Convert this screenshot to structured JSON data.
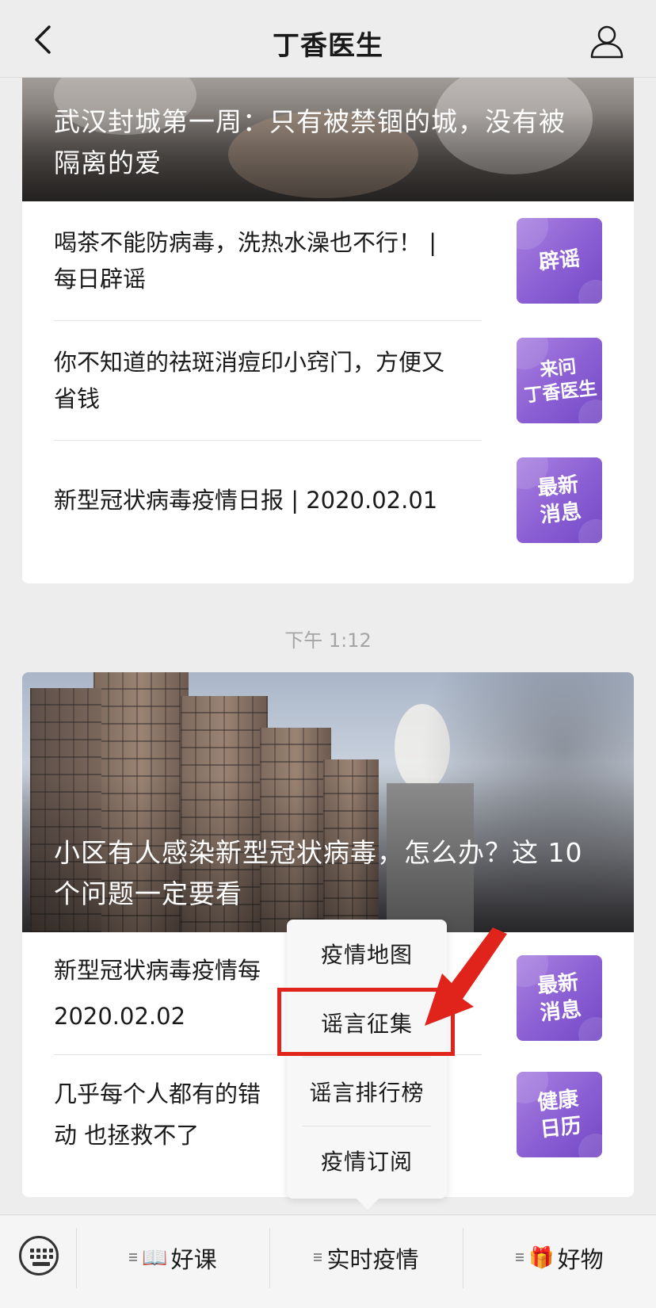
{
  "header": {
    "title": "丁香医生",
    "back_icon": "chevron-left-icon",
    "profile_icon": "person-icon"
  },
  "feed1": {
    "hero_title": "武汉封城第一周：只有被禁锢的城，没有被隔离的爱",
    "items": [
      {
        "text": "喝茶不能防病毒，洗热水澡也不行！ | 每日辟谣",
        "badge": "辟谣"
      },
      {
        "text": "你不知道的祛斑消痘印小窍门，方便又省钱",
        "badge": "来问\n丁香医生"
      },
      {
        "text": "新型冠状病毒疫情日报 | 2020.02.01",
        "badge": "最新\n消息"
      }
    ]
  },
  "timestamp": "下午 1:12",
  "feed2": {
    "hero_title": "小区有人感染新型冠状病毒，怎么办？这 10 个问题一定要看",
    "items": [
      {
        "text": "新型冠状病毒疫情每 2020.02.02",
        "badge": "最新\n消息"
      },
      {
        "text": "几乎每个人都有的错 动 也拯救不了",
        "badge": "健康\n日历"
      }
    ]
  },
  "popup_menu": {
    "items": [
      "疫情地图",
      "谣言征集",
      "谣言排行榜",
      "疫情订阅"
    ],
    "highlighted": "谣言征集",
    "highlight_color": "#e0241c"
  },
  "bottom_bar": {
    "keyboard_icon": "keyboard-icon",
    "tabs": [
      {
        "label": "好课",
        "icon": "📖"
      },
      {
        "label": "实时疫情",
        "icon": ""
      },
      {
        "label": "好物",
        "icon": "🎁"
      }
    ]
  },
  "colors": {
    "badge_purple": "#8a5ed3",
    "background": "#ededed",
    "timestamp_gray": "#a5a5a5"
  }
}
